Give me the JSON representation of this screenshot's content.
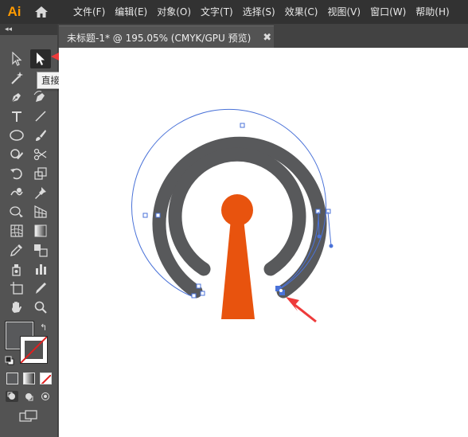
{
  "app": {
    "logo": "Ai"
  },
  "menu": {
    "items": [
      "文件(F)",
      "编辑(E)",
      "对象(O)",
      "文字(T)",
      "选择(S)",
      "效果(C)",
      "视图(V)",
      "窗口(W)",
      "帮助(H)"
    ]
  },
  "document": {
    "tab_title": "未标题-1* @ 195.05% (CMYK/GPU 预览)",
    "close_glyph": "✖"
  },
  "toolbar": {
    "collapse_glyph": "◂◂",
    "tooltip": "直接选择工具 (A)",
    "selected_tool": "direct-selection-tool",
    "tools": [
      "selection-tool",
      "direct-selection-tool",
      "magic-wand-tool",
      "lasso-tool",
      "pen-tool",
      "curvature-tool",
      "type-tool",
      "line-segment-tool",
      "ellipse-tool",
      "paintbrush-tool",
      "shaper-tool",
      "scissors-tool",
      "rotate-tool",
      "scale-tool",
      "warp-tool",
      "puppet-warp-tool",
      "shape-builder-tool",
      "perspective-grid-tool",
      "mesh-tool",
      "gradient-tool",
      "eyedropper-tool",
      "blend-tool",
      "symbol-sprayer-tool",
      "column-graph-tool",
      "artboard-tool",
      "slice-tool",
      "hand-tool",
      "zoom-tool"
    ],
    "swap_glyph": "↰"
  },
  "colors": {
    "fill": "#58595b",
    "stroke": "none",
    "accent": "#e8530e",
    "selection": "#4a72d8",
    "annotation_arrow": "#ee3b3b"
  }
}
